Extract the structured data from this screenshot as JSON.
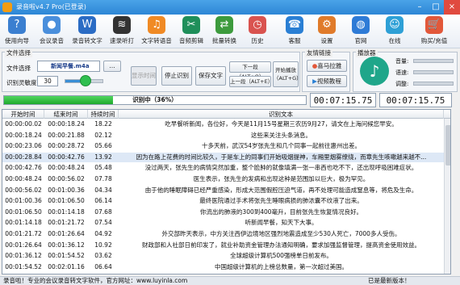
{
  "window": {
    "title": "录音啦v4.7 Pro(已登录)"
  },
  "toolbar": [
    {
      "label": "使用向导",
      "icon": "guide-icon",
      "color": "#3b7fd0",
      "glyph": "?"
    },
    {
      "label": "会议录音",
      "icon": "microphone-icon",
      "color": "#4a8fdc",
      "glyph": "●"
    },
    {
      "label": "录音转文字",
      "icon": "wordfile-icon",
      "color": "#2b6cc4",
      "glyph": "W"
    },
    {
      "label": "速录听打",
      "icon": "waveform-icon",
      "color": "#333333",
      "glyph": "≋"
    },
    {
      "label": "文字转语音",
      "icon": "text-to-speech-icon",
      "color": "#f08a24",
      "glyph": "♫"
    },
    {
      "label": "音频剪辑",
      "icon": "audio-edit-icon",
      "color": "#1f8f5a",
      "glyph": "✂"
    },
    {
      "label": "批量转换",
      "icon": "batch-convert-icon",
      "color": "#3d9b3d",
      "glyph": "⇄"
    },
    {
      "label": "历史",
      "icon": "history-icon",
      "color": "#d9534f",
      "glyph": "◷"
    },
    {
      "label": "客服",
      "icon": "support-icon",
      "color": "#2a7fd4",
      "glyph": "☎"
    },
    {
      "label": "设置",
      "icon": "settings-icon",
      "color": "#e07b2a",
      "glyph": "⚙"
    },
    {
      "label": "官网",
      "icon": "website-icon",
      "color": "#2e7bd6",
      "glyph": "◍"
    },
    {
      "label": "在线",
      "icon": "online-icon",
      "color": "#2ea0d6",
      "glyph": "☺"
    },
    {
      "label": "购买/充值",
      "icon": "cart-icon",
      "color": "#e2583a",
      "glyph": "🛒"
    }
  ],
  "file_group": {
    "title": "文件选择",
    "file_label": "文件选择",
    "file_value": "新闻早餐.m4a",
    "lang_label": "识别灵敏度",
    "lang_value": "30",
    "slider_level": 0.55,
    "btn_show_time": "显示时间",
    "btn_stop": "停止识别",
    "btn_save": "保存文字",
    "btn_next": "下一段（ALT+Q）",
    "btn_prev": "上一段（ALT+E）",
    "btn_start": "开始播放（ALT+G）"
  },
  "friend_group": {
    "title": "友情链接",
    "btn1": "喜马拉雅",
    "btn2": "视频教程"
  },
  "player": {
    "title": "播放器",
    "volume_label": "音量:",
    "speed_label": "语速:",
    "pitch_label": "调整:"
  },
  "progress": {
    "label": "识别中（36%）",
    "percent": 36,
    "time_current": "00:07:15.75",
    "time_total": "00:07:15.75"
  },
  "table": {
    "headers": [
      "开始时间",
      "结束时间",
      "持续时间",
      "识别文本"
    ],
    "rows": [
      [
        "00:00:00.02",
        "00:00:18.24",
        "18.22",
        "吃早餐听新闻，各位好，今天是11月15号星期三农历9月27，请文在上海问候您早安。"
      ],
      [
        "00:00:18.24",
        "00:00:21.88",
        "02.12",
        "这些来关注头条消息。"
      ],
      [
        "00:00:23.06",
        "00:00:28.72",
        "05.66",
        "十多天前，武汉54岁张先生和几个同事一起前往惠州出差。"
      ],
      [
        "00:00:28.84",
        "00:00:42.76",
        "13.92",
        "因为在路上花费的时间比较久，于是车上的同事们开始吸烟提神，车厢里烟雾缭绕，而章先生咳嗽越来越不..."
      ],
      [
        "00:00:42.76",
        "00:00:48.24",
        "05.48",
        "没过两天，张先生的病情突然加重，整个脸肿的就像填满一张一串西也吃不下，还出现呼吸困难症状。"
      ],
      [
        "00:00:48.24",
        "00:00:56.02",
        "07.78",
        "医生表示，张先生的发病和出现这种是范围加以巨大，极为罕见。"
      ],
      [
        "00:00:56.02",
        "00:01:00.36",
        "04.34",
        "由于他的睡眠障碍已经严重感染，形成大范围假腔压迫气道，再不处理可能造成窒息等，将危及生命。"
      ],
      [
        "00:01:00.36",
        "00:01:06.50",
        "06.14",
        "最终医院通过手术将张先生睡眼病损的肺浓囊不纹液了出来。"
      ],
      [
        "00:01:06.50",
        "00:01:14.18",
        "07.68",
        "你流出的肺液的300到400毫升，目前张先生恢复情况良好。"
      ],
      [
        "00:01:14.18",
        "00:01:21.72",
        "07.54",
        "听新闻早餐，知天下大事。"
      ],
      [
        "00:01:21.72",
        "00:01:26.64",
        "04.92",
        "外交部昨天表示，中方关注西伊边境地区强烈地震造成至少530人死亡，7000多人受伤。"
      ],
      [
        "00:01:26.64",
        "00:01:36.12",
        "10.92",
        "财政部和人社部日前印发了，就业补助资金管理办法通知明确，要求加强监督管理，提高资金使用效益。"
      ],
      [
        "00:01:36.12",
        "00:01:54.52",
        "03.62",
        "全球超级计算机500强榜单日前发布。"
      ],
      [
        "00:01:54.52",
        "00:02:01.16",
        "06.64",
        "中国超级计算机的上榜总数量，第一次超过美国。"
      ]
    ]
  },
  "status": {
    "left": "录音啦！专业的会议录音转文字软件，官方网址：www.luyinla.com",
    "right": "已是最新版本！"
  }
}
